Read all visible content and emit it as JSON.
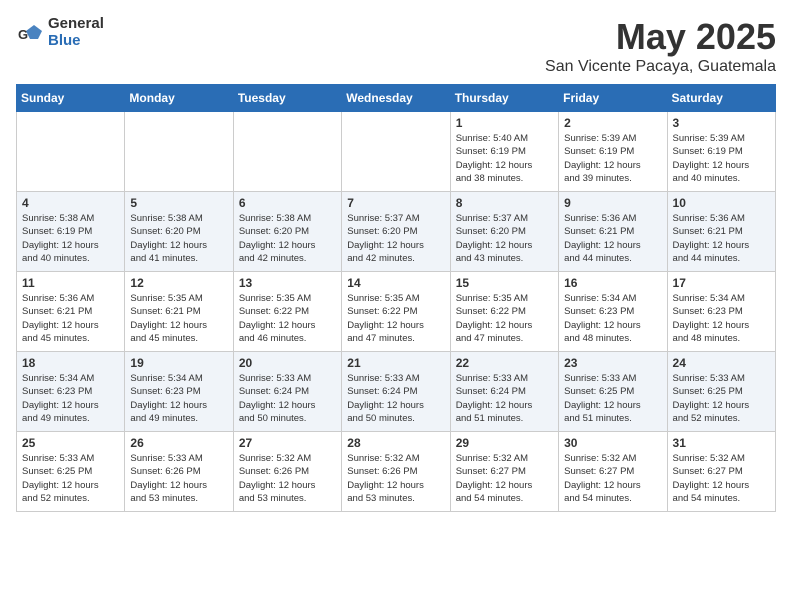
{
  "logo": {
    "general": "General",
    "blue": "Blue"
  },
  "title": {
    "month": "May 2025",
    "location": "San Vicente Pacaya, Guatemala"
  },
  "calendar": {
    "headers": [
      "Sunday",
      "Monday",
      "Tuesday",
      "Wednesday",
      "Thursday",
      "Friday",
      "Saturday"
    ],
    "weeks": [
      [
        {
          "day": "",
          "info": ""
        },
        {
          "day": "",
          "info": ""
        },
        {
          "day": "",
          "info": ""
        },
        {
          "day": "",
          "info": ""
        },
        {
          "day": "1",
          "info": "Sunrise: 5:40 AM\nSunset: 6:19 PM\nDaylight: 12 hours\nand 38 minutes."
        },
        {
          "day": "2",
          "info": "Sunrise: 5:39 AM\nSunset: 6:19 PM\nDaylight: 12 hours\nand 39 minutes."
        },
        {
          "day": "3",
          "info": "Sunrise: 5:39 AM\nSunset: 6:19 PM\nDaylight: 12 hours\nand 40 minutes."
        }
      ],
      [
        {
          "day": "4",
          "info": "Sunrise: 5:38 AM\nSunset: 6:19 PM\nDaylight: 12 hours\nand 40 minutes."
        },
        {
          "day": "5",
          "info": "Sunrise: 5:38 AM\nSunset: 6:20 PM\nDaylight: 12 hours\nand 41 minutes."
        },
        {
          "day": "6",
          "info": "Sunrise: 5:38 AM\nSunset: 6:20 PM\nDaylight: 12 hours\nand 42 minutes."
        },
        {
          "day": "7",
          "info": "Sunrise: 5:37 AM\nSunset: 6:20 PM\nDaylight: 12 hours\nand 42 minutes."
        },
        {
          "day": "8",
          "info": "Sunrise: 5:37 AM\nSunset: 6:20 PM\nDaylight: 12 hours\nand 43 minutes."
        },
        {
          "day": "9",
          "info": "Sunrise: 5:36 AM\nSunset: 6:21 PM\nDaylight: 12 hours\nand 44 minutes."
        },
        {
          "day": "10",
          "info": "Sunrise: 5:36 AM\nSunset: 6:21 PM\nDaylight: 12 hours\nand 44 minutes."
        }
      ],
      [
        {
          "day": "11",
          "info": "Sunrise: 5:36 AM\nSunset: 6:21 PM\nDaylight: 12 hours\nand 45 minutes."
        },
        {
          "day": "12",
          "info": "Sunrise: 5:35 AM\nSunset: 6:21 PM\nDaylight: 12 hours\nand 45 minutes."
        },
        {
          "day": "13",
          "info": "Sunrise: 5:35 AM\nSunset: 6:22 PM\nDaylight: 12 hours\nand 46 minutes."
        },
        {
          "day": "14",
          "info": "Sunrise: 5:35 AM\nSunset: 6:22 PM\nDaylight: 12 hours\nand 47 minutes."
        },
        {
          "day": "15",
          "info": "Sunrise: 5:35 AM\nSunset: 6:22 PM\nDaylight: 12 hours\nand 47 minutes."
        },
        {
          "day": "16",
          "info": "Sunrise: 5:34 AM\nSunset: 6:23 PM\nDaylight: 12 hours\nand 48 minutes."
        },
        {
          "day": "17",
          "info": "Sunrise: 5:34 AM\nSunset: 6:23 PM\nDaylight: 12 hours\nand 48 minutes."
        }
      ],
      [
        {
          "day": "18",
          "info": "Sunrise: 5:34 AM\nSunset: 6:23 PM\nDaylight: 12 hours\nand 49 minutes."
        },
        {
          "day": "19",
          "info": "Sunrise: 5:34 AM\nSunset: 6:23 PM\nDaylight: 12 hours\nand 49 minutes."
        },
        {
          "day": "20",
          "info": "Sunrise: 5:33 AM\nSunset: 6:24 PM\nDaylight: 12 hours\nand 50 minutes."
        },
        {
          "day": "21",
          "info": "Sunrise: 5:33 AM\nSunset: 6:24 PM\nDaylight: 12 hours\nand 50 minutes."
        },
        {
          "day": "22",
          "info": "Sunrise: 5:33 AM\nSunset: 6:24 PM\nDaylight: 12 hours\nand 51 minutes."
        },
        {
          "day": "23",
          "info": "Sunrise: 5:33 AM\nSunset: 6:25 PM\nDaylight: 12 hours\nand 51 minutes."
        },
        {
          "day": "24",
          "info": "Sunrise: 5:33 AM\nSunset: 6:25 PM\nDaylight: 12 hours\nand 52 minutes."
        }
      ],
      [
        {
          "day": "25",
          "info": "Sunrise: 5:33 AM\nSunset: 6:25 PM\nDaylight: 12 hours\nand 52 minutes."
        },
        {
          "day": "26",
          "info": "Sunrise: 5:33 AM\nSunset: 6:26 PM\nDaylight: 12 hours\nand 53 minutes."
        },
        {
          "day": "27",
          "info": "Sunrise: 5:32 AM\nSunset: 6:26 PM\nDaylight: 12 hours\nand 53 minutes."
        },
        {
          "day": "28",
          "info": "Sunrise: 5:32 AM\nSunset: 6:26 PM\nDaylight: 12 hours\nand 53 minutes."
        },
        {
          "day": "29",
          "info": "Sunrise: 5:32 AM\nSunset: 6:27 PM\nDaylight: 12 hours\nand 54 minutes."
        },
        {
          "day": "30",
          "info": "Sunrise: 5:32 AM\nSunset: 6:27 PM\nDaylight: 12 hours\nand 54 minutes."
        },
        {
          "day": "31",
          "info": "Sunrise: 5:32 AM\nSunset: 6:27 PM\nDaylight: 12 hours\nand 54 minutes."
        }
      ]
    ]
  }
}
